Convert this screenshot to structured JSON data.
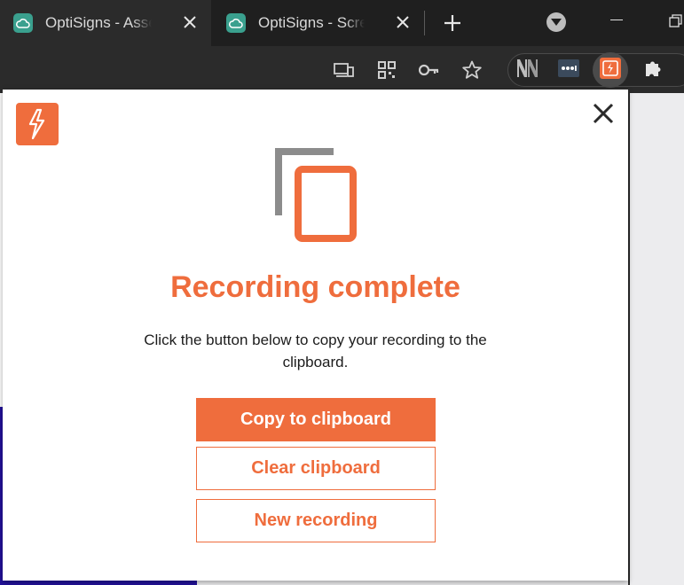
{
  "tabs": [
    {
      "title": "OptiSigns - Assets",
      "active": true
    },
    {
      "title": "OptiSigns - Screens",
      "active": false
    }
  ],
  "toolbar_icons": [
    "cast-icon",
    "qr-code-icon",
    "password-key-icon",
    "bookmark-star-icon"
  ],
  "extensions": [
    "nn-extension-icon",
    "password-dots-extension-icon",
    "recorder-extension-icon",
    "puzzle-extensions-icon"
  ],
  "popup": {
    "headline": "Recording complete",
    "description": "Click the button below to copy your recording to the clipboard.",
    "buttons": {
      "copy": "Copy to clipboard",
      "clear": "Clear clipboard",
      "new_recording": "New recording"
    }
  },
  "colors": {
    "accent": "#ef6d3d",
    "illustration_gray": "#8c8c8c",
    "chrome_dark": "#1f1f1f",
    "chrome_toolbar": "#2b2b2b",
    "tab_favicon": "#3aa08e"
  }
}
